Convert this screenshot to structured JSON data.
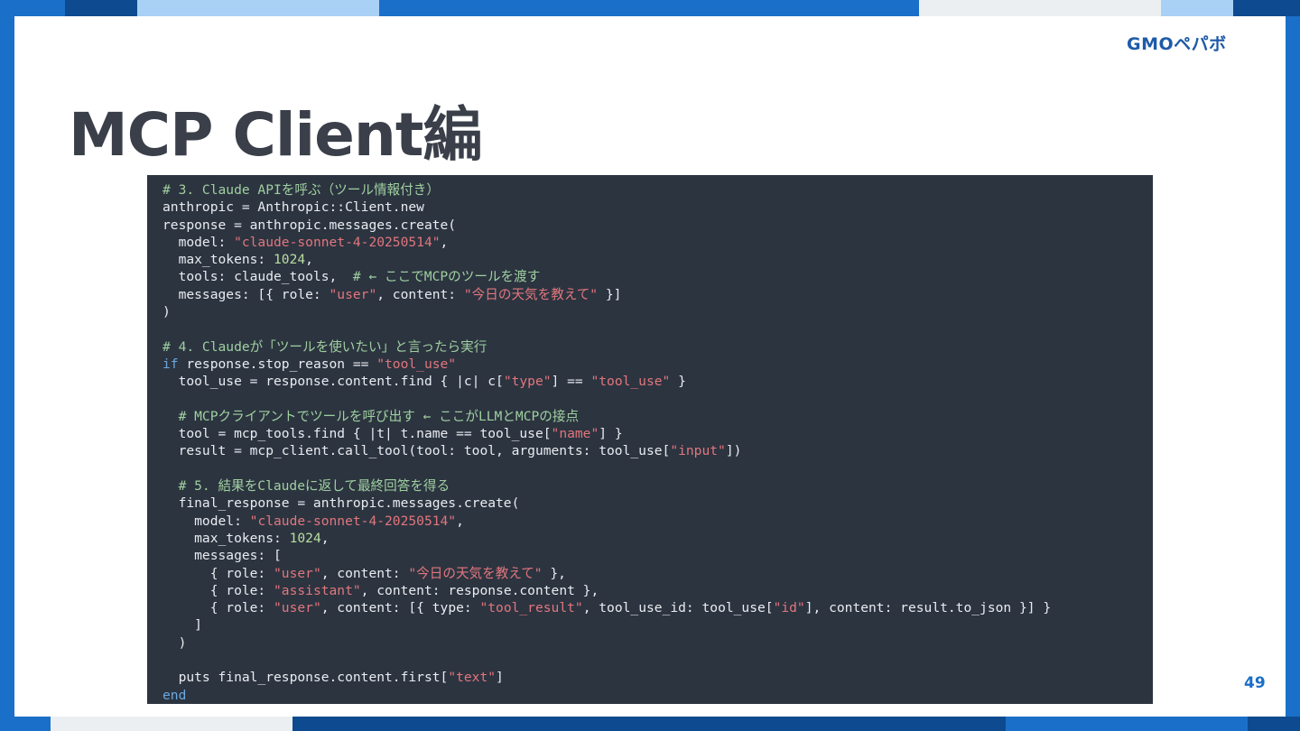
{
  "slide": {
    "title": "MCP Client編",
    "page_number": "49",
    "logo_text": "GMOペパボ"
  },
  "colors": {
    "background": "#ffffff",
    "frame_blue": "#1a6fc8",
    "frame_navy": "#0d4a8f",
    "frame_light": "#a9d0f5",
    "frame_grey": "#eceff2",
    "title_text": "#3a3f4a",
    "code_background": "#2c3440",
    "code_text": "#e9ecf0",
    "code_comment": "#9fd0a0",
    "code_string": "#e1767d",
    "code_number": "#b9df9f",
    "code_keyword": "#6aa8e0",
    "page_number": "#1a6fc8",
    "logo": "#1e5aa8"
  },
  "code": {
    "language": "ruby",
    "lines": [
      [
        {
          "t": "comment",
          "v": "# 3. Claude APIを呼ぶ（ツール情報付き）"
        }
      ],
      [
        {
          "t": "plain",
          "v": "anthropic = Anthropic::Client.new"
        }
      ],
      [
        {
          "t": "plain",
          "v": "response = anthropic.messages.create("
        }
      ],
      [
        {
          "t": "plain",
          "v": "  model: "
        },
        {
          "t": "string",
          "v": "\"claude-sonnet-4-20250514\""
        },
        {
          "t": "plain",
          "v": ","
        }
      ],
      [
        {
          "t": "plain",
          "v": "  max_tokens: "
        },
        {
          "t": "number",
          "v": "1024"
        },
        {
          "t": "plain",
          "v": ","
        }
      ],
      [
        {
          "t": "plain",
          "v": "  tools: claude_tools,  "
        },
        {
          "t": "comment",
          "v": "# ← ここでMCPのツールを渡す"
        }
      ],
      [
        {
          "t": "plain",
          "v": "  messages: [{ role: "
        },
        {
          "t": "string",
          "v": "\"user\""
        },
        {
          "t": "plain",
          "v": ", content: "
        },
        {
          "t": "string",
          "v": "\"今日の天気を教えて\""
        },
        {
          "t": "plain",
          "v": " }]"
        }
      ],
      [
        {
          "t": "plain",
          "v": ")"
        }
      ],
      [
        {
          "t": "plain",
          "v": ""
        }
      ],
      [
        {
          "t": "comment",
          "v": "# 4. Claudeが「ツールを使いたい」と言ったら実行"
        }
      ],
      [
        {
          "t": "keyword",
          "v": "if"
        },
        {
          "t": "plain",
          "v": " response.stop_reason == "
        },
        {
          "t": "string",
          "v": "\"tool_use\""
        }
      ],
      [
        {
          "t": "plain",
          "v": "  tool_use = response.content.find { |c| c["
        },
        {
          "t": "string",
          "v": "\"type\""
        },
        {
          "t": "plain",
          "v": "] == "
        },
        {
          "t": "string",
          "v": "\"tool_use\""
        },
        {
          "t": "plain",
          "v": " }"
        }
      ],
      [
        {
          "t": "plain",
          "v": ""
        }
      ],
      [
        {
          "t": "plain",
          "v": "  "
        },
        {
          "t": "comment",
          "v": "# MCPクライアントでツールを呼び出す ← ここがLLMとMCPの接点"
        }
      ],
      [
        {
          "t": "plain",
          "v": "  tool = mcp_tools.find { |t| t.name == tool_use["
        },
        {
          "t": "string",
          "v": "\"name\""
        },
        {
          "t": "plain",
          "v": "] }"
        }
      ],
      [
        {
          "t": "plain",
          "v": "  result = mcp_client.call_tool(tool: tool, arguments: tool_use["
        },
        {
          "t": "string",
          "v": "\"input\""
        },
        {
          "t": "plain",
          "v": "])"
        }
      ],
      [
        {
          "t": "plain",
          "v": ""
        }
      ],
      [
        {
          "t": "plain",
          "v": "  "
        },
        {
          "t": "comment",
          "v": "# 5. 結果をClaudeに返して最終回答を得る"
        }
      ],
      [
        {
          "t": "plain",
          "v": "  final_response = anthropic.messages.create("
        }
      ],
      [
        {
          "t": "plain",
          "v": "    model: "
        },
        {
          "t": "string",
          "v": "\"claude-sonnet-4-20250514\""
        },
        {
          "t": "plain",
          "v": ","
        }
      ],
      [
        {
          "t": "plain",
          "v": "    max_tokens: "
        },
        {
          "t": "number",
          "v": "1024"
        },
        {
          "t": "plain",
          "v": ","
        }
      ],
      [
        {
          "t": "plain",
          "v": "    messages: ["
        }
      ],
      [
        {
          "t": "plain",
          "v": "      { role: "
        },
        {
          "t": "string",
          "v": "\"user\""
        },
        {
          "t": "plain",
          "v": ", content: "
        },
        {
          "t": "string",
          "v": "\"今日の天気を教えて\""
        },
        {
          "t": "plain",
          "v": " },"
        }
      ],
      [
        {
          "t": "plain",
          "v": "      { role: "
        },
        {
          "t": "string",
          "v": "\"assistant\""
        },
        {
          "t": "plain",
          "v": ", content: response.content },"
        }
      ],
      [
        {
          "t": "plain",
          "v": "      { role: "
        },
        {
          "t": "string",
          "v": "\"user\""
        },
        {
          "t": "plain",
          "v": ", content: [{ type: "
        },
        {
          "t": "string",
          "v": "\"tool_result\""
        },
        {
          "t": "plain",
          "v": ", tool_use_id: tool_use["
        },
        {
          "t": "string",
          "v": "\"id\""
        },
        {
          "t": "plain",
          "v": "], content: result.to_json }] }"
        }
      ],
      [
        {
          "t": "plain",
          "v": "    ]"
        }
      ],
      [
        {
          "t": "plain",
          "v": "  )"
        }
      ],
      [
        {
          "t": "plain",
          "v": ""
        }
      ],
      [
        {
          "t": "plain",
          "v": "  puts final_response.content.first["
        },
        {
          "t": "string",
          "v": "\"text\""
        },
        {
          "t": "plain",
          "v": "]"
        }
      ],
      [
        {
          "t": "keyword",
          "v": "end"
        }
      ]
    ]
  }
}
